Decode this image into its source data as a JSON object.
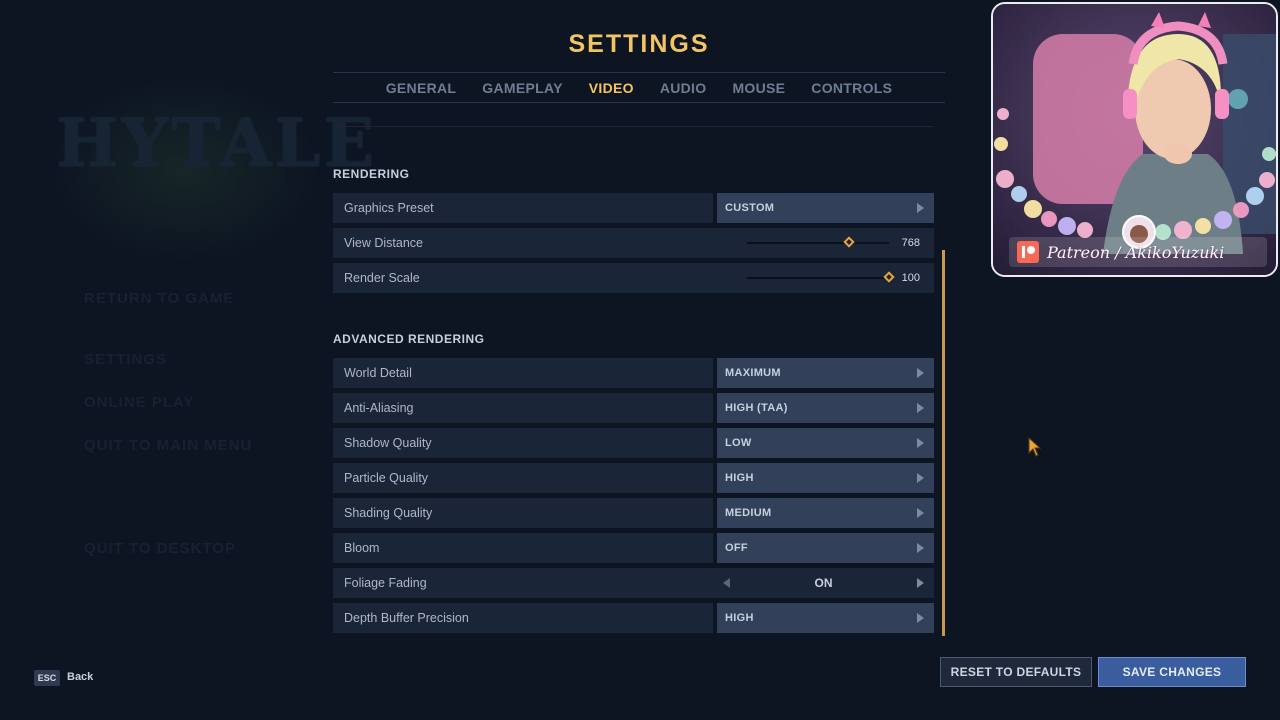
{
  "background": {
    "logo_text": "HYTALE",
    "pause_menu": [
      "RETURN TO GAME",
      "SETTINGS",
      "ONLINE PLAY",
      "QUIT TO MAIN MENU",
      "QUIT TO DESKTOP"
    ]
  },
  "settings": {
    "title": "SETTINGS",
    "tabs": [
      {
        "label": "GENERAL"
      },
      {
        "label": "GAMEPLAY"
      },
      {
        "label": "VIDEO"
      },
      {
        "label": "AUDIO"
      },
      {
        "label": "MOUSE"
      },
      {
        "label": "CONTROLS"
      }
    ],
    "active_tab": "VIDEO",
    "rendering": {
      "title": "RENDERING",
      "graphics_preset": {
        "label": "Graphics Preset",
        "value": "CUSTOM"
      },
      "view_distance": {
        "label": "View Distance",
        "value": "768",
        "fraction": 0.72
      },
      "render_scale": {
        "label": "Render Scale",
        "value": "100",
        "fraction": 1.0
      }
    },
    "advanced": {
      "title": "ADVANCED RENDERING",
      "world_detail": {
        "label": "World Detail",
        "value": "MAXIMUM"
      },
      "anti_aliasing": {
        "label": "Anti-Aliasing",
        "value": "HIGH (TAA)"
      },
      "shadow_quality": {
        "label": "Shadow Quality",
        "value": "LOW"
      },
      "particle_quality": {
        "label": "Particle Quality",
        "value": "HIGH"
      },
      "shading_quality": {
        "label": "Shading Quality",
        "value": "MEDIUM"
      },
      "bloom": {
        "label": "Bloom",
        "value": "OFF"
      },
      "foliage_fading": {
        "label": "Foliage Fading",
        "value": "ON"
      },
      "depth_buffer": {
        "label": "Depth Buffer Precision",
        "value": "HIGH"
      }
    }
  },
  "footer": {
    "esc_key": "ESC",
    "back_label": "Back",
    "reset_label": "RESET TO DEFAULTS",
    "save_label": "SAVE CHANGES"
  },
  "webcam": {
    "banner_text": "Patreon / AkikoYuzuki"
  },
  "colors": {
    "accent": "#f2c462",
    "background": "#0d1523",
    "row": "#1a2537",
    "select": "#32405a",
    "save_button": "#3a5da0"
  }
}
